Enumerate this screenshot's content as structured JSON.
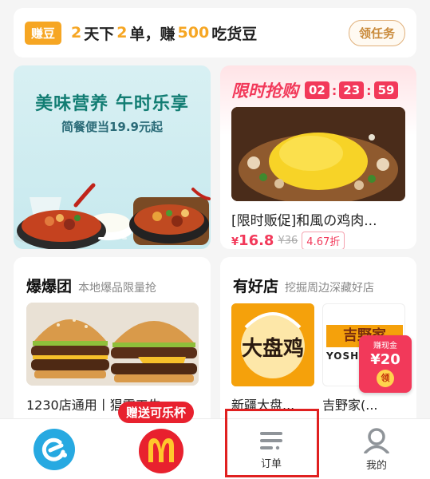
{
  "banner": {
    "tag": "赚豆",
    "parts": [
      "2",
      "天下",
      "2",
      "单，赚",
      "500",
      "吃货豆"
    ],
    "task_button": "领任务"
  },
  "promo": {
    "title": "美味营养 午时乐享",
    "subtitle": "简餐便当19.9元起"
  },
  "flash_sale": {
    "title": "限时抢购",
    "timer": [
      "02",
      "23",
      "59"
    ],
    "item_name": "[限时贩促]和風の鸡肉...",
    "currency": "¥",
    "price": "16.8",
    "old_price": "¥36",
    "discount": "4.67折"
  },
  "baobao": {
    "title": "爆爆团",
    "subtitle": "本地爆品限量抢",
    "item_name": "1230店通用丨猖霸工牛"
  },
  "good_shops": {
    "title": "有好店",
    "subtitle": "挖掘周边深藏好店",
    "shop1_logo_text": "大盘鸡",
    "shop1_name": "新疆大盘...",
    "shop2_logo_text": "吉野家",
    "shop2_logo_sub": "YOSHI",
    "shop2_name": "吉野家(..."
  },
  "cash_badge": {
    "label": "赚现金",
    "amount": "¥20",
    "button": "领"
  },
  "tabbar": {
    "mcd_badge": "赠送可乐杯",
    "orders_label": "订单",
    "mine_label": "我的"
  },
  "colors": {
    "accent_orange": "#f6a623",
    "flash_red": "#f2395a",
    "promo_green": "#127d73",
    "brand_blue": "#27a9e1",
    "mcd_red": "#e8212e"
  }
}
